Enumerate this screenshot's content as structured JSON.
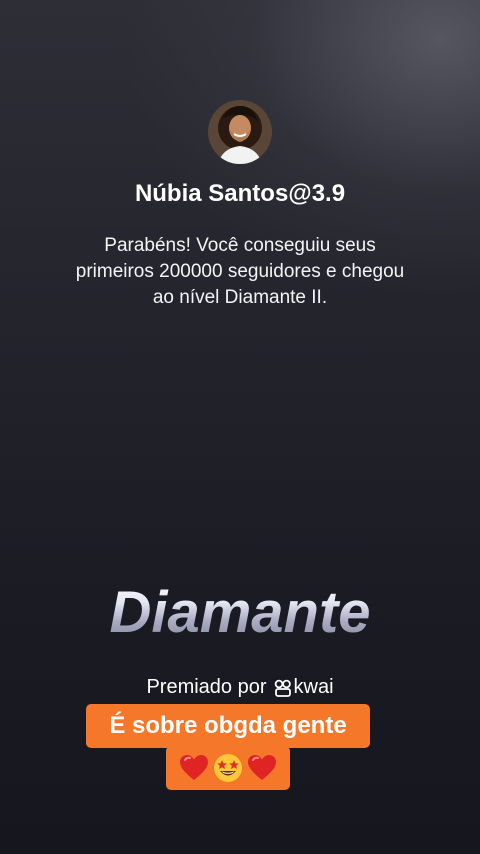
{
  "profile": {
    "avatar_icon": "user-photo-avatar",
    "name": "Núbia Santos@3.9"
  },
  "message": {
    "text": "Parabéns! Você conseguiu seus primeiros 200000 seguidores e chegou ao nível Diamante II."
  },
  "level": {
    "title": "Diamante"
  },
  "award": {
    "label": "Premiado por",
    "brand_icon": "kwai-logo-icon",
    "brand_name": "kwai"
  },
  "caption": {
    "line1": "É sobre obgda gente",
    "line2_emojis": [
      "red-heart-emoji",
      "star-struck-emoji",
      "red-heart-emoji"
    ],
    "background_color": "#f4772a"
  },
  "colors": {
    "background": "#1f1f28",
    "accent_orange": "#f4772a",
    "text": "#ffffff"
  }
}
